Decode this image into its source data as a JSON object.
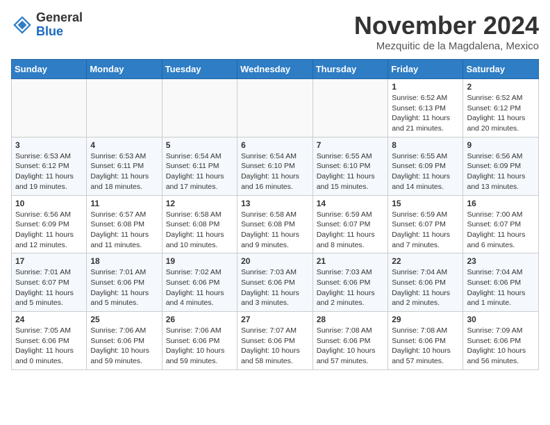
{
  "header": {
    "logo_line1": "General",
    "logo_line2": "Blue",
    "month": "November 2024",
    "location": "Mezquitic de la Magdalena, Mexico"
  },
  "weekdays": [
    "Sunday",
    "Monday",
    "Tuesday",
    "Wednesday",
    "Thursday",
    "Friday",
    "Saturday"
  ],
  "weeks": [
    [
      {
        "day": "",
        "info": ""
      },
      {
        "day": "",
        "info": ""
      },
      {
        "day": "",
        "info": ""
      },
      {
        "day": "",
        "info": ""
      },
      {
        "day": "",
        "info": ""
      },
      {
        "day": "1",
        "info": "Sunrise: 6:52 AM\nSunset: 6:13 PM\nDaylight: 11 hours and 21 minutes."
      },
      {
        "day": "2",
        "info": "Sunrise: 6:52 AM\nSunset: 6:12 PM\nDaylight: 11 hours and 20 minutes."
      }
    ],
    [
      {
        "day": "3",
        "info": "Sunrise: 6:53 AM\nSunset: 6:12 PM\nDaylight: 11 hours and 19 minutes."
      },
      {
        "day": "4",
        "info": "Sunrise: 6:53 AM\nSunset: 6:11 PM\nDaylight: 11 hours and 18 minutes."
      },
      {
        "day": "5",
        "info": "Sunrise: 6:54 AM\nSunset: 6:11 PM\nDaylight: 11 hours and 17 minutes."
      },
      {
        "day": "6",
        "info": "Sunrise: 6:54 AM\nSunset: 6:10 PM\nDaylight: 11 hours and 16 minutes."
      },
      {
        "day": "7",
        "info": "Sunrise: 6:55 AM\nSunset: 6:10 PM\nDaylight: 11 hours and 15 minutes."
      },
      {
        "day": "8",
        "info": "Sunrise: 6:55 AM\nSunset: 6:09 PM\nDaylight: 11 hours and 14 minutes."
      },
      {
        "day": "9",
        "info": "Sunrise: 6:56 AM\nSunset: 6:09 PM\nDaylight: 11 hours and 13 minutes."
      }
    ],
    [
      {
        "day": "10",
        "info": "Sunrise: 6:56 AM\nSunset: 6:09 PM\nDaylight: 11 hours and 12 minutes."
      },
      {
        "day": "11",
        "info": "Sunrise: 6:57 AM\nSunset: 6:08 PM\nDaylight: 11 hours and 11 minutes."
      },
      {
        "day": "12",
        "info": "Sunrise: 6:58 AM\nSunset: 6:08 PM\nDaylight: 11 hours and 10 minutes."
      },
      {
        "day": "13",
        "info": "Sunrise: 6:58 AM\nSunset: 6:08 PM\nDaylight: 11 hours and 9 minutes."
      },
      {
        "day": "14",
        "info": "Sunrise: 6:59 AM\nSunset: 6:07 PM\nDaylight: 11 hours and 8 minutes."
      },
      {
        "day": "15",
        "info": "Sunrise: 6:59 AM\nSunset: 6:07 PM\nDaylight: 11 hours and 7 minutes."
      },
      {
        "day": "16",
        "info": "Sunrise: 7:00 AM\nSunset: 6:07 PM\nDaylight: 11 hours and 6 minutes."
      }
    ],
    [
      {
        "day": "17",
        "info": "Sunrise: 7:01 AM\nSunset: 6:07 PM\nDaylight: 11 hours and 5 minutes."
      },
      {
        "day": "18",
        "info": "Sunrise: 7:01 AM\nSunset: 6:06 PM\nDaylight: 11 hours and 5 minutes."
      },
      {
        "day": "19",
        "info": "Sunrise: 7:02 AM\nSunset: 6:06 PM\nDaylight: 11 hours and 4 minutes."
      },
      {
        "day": "20",
        "info": "Sunrise: 7:03 AM\nSunset: 6:06 PM\nDaylight: 11 hours and 3 minutes."
      },
      {
        "day": "21",
        "info": "Sunrise: 7:03 AM\nSunset: 6:06 PM\nDaylight: 11 hours and 2 minutes."
      },
      {
        "day": "22",
        "info": "Sunrise: 7:04 AM\nSunset: 6:06 PM\nDaylight: 11 hours and 2 minutes."
      },
      {
        "day": "23",
        "info": "Sunrise: 7:04 AM\nSunset: 6:06 PM\nDaylight: 11 hours and 1 minute."
      }
    ],
    [
      {
        "day": "24",
        "info": "Sunrise: 7:05 AM\nSunset: 6:06 PM\nDaylight: 11 hours and 0 minutes."
      },
      {
        "day": "25",
        "info": "Sunrise: 7:06 AM\nSunset: 6:06 PM\nDaylight: 10 hours and 59 minutes."
      },
      {
        "day": "26",
        "info": "Sunrise: 7:06 AM\nSunset: 6:06 PM\nDaylight: 10 hours and 59 minutes."
      },
      {
        "day": "27",
        "info": "Sunrise: 7:07 AM\nSunset: 6:06 PM\nDaylight: 10 hours and 58 minutes."
      },
      {
        "day": "28",
        "info": "Sunrise: 7:08 AM\nSunset: 6:06 PM\nDaylight: 10 hours and 57 minutes."
      },
      {
        "day": "29",
        "info": "Sunrise: 7:08 AM\nSunset: 6:06 PM\nDaylight: 10 hours and 57 minutes."
      },
      {
        "day": "30",
        "info": "Sunrise: 7:09 AM\nSunset: 6:06 PM\nDaylight: 10 hours and 56 minutes."
      }
    ]
  ]
}
